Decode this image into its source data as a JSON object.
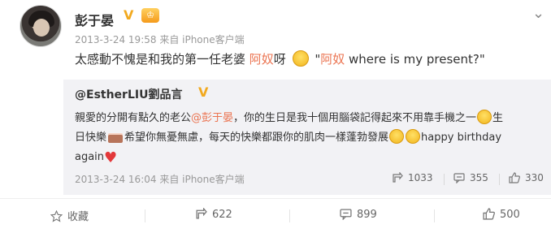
{
  "post": {
    "author": "彭于晏",
    "meta": "2013-3-24 19:58 来自 iPhone客户端",
    "content_parts": {
      "a": "太感動不愧是和我的第一任老婆 ",
      "mention1": "阿奴",
      "b": "呀 ",
      "c": " \"",
      "mention2": "阿奴",
      "d": " where is my present?\""
    }
  },
  "repost": {
    "author": "@EstherLIU劉品言",
    "line1_a": "親愛的分開有點久的老公",
    "line1_mention": "@彭于晏",
    "line1_b": "，你的生日是我十個用腦袋記得起來不用靠手機之一",
    "line1_c": "生",
    "line2_a": "日快樂",
    "line2_b": "希望你無憂無慮，每天的快樂都跟你的肌肉一樣蓬勃發展",
    "line2_c": "happy birthday",
    "line3_a": "again",
    "meta": "2013-3-24 16:04 来自 iPhone客户端",
    "forward_count": "1033",
    "comment_count": "355",
    "like_count": "330"
  },
  "actions": {
    "favorite": "收藏",
    "forward": "622",
    "comment": "899",
    "like": "500"
  },
  "colors": {
    "mention": "#eb7350",
    "verified": "#f2a91e",
    "repost_bg": "#f2f2f5"
  }
}
